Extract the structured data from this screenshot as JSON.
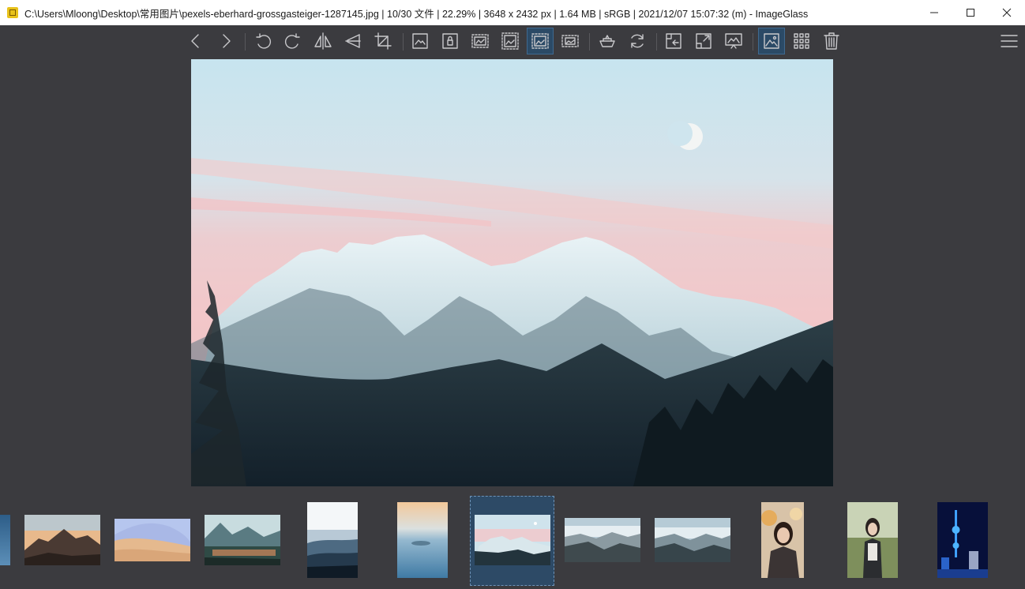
{
  "window": {
    "title": "C:\\Users\\Mloong\\Desktop\\常用图片\\pexels-eberhard-grossgasteiger-1287145.jpg  |  10/30 文件  |  22.29%  |  3648 x 2432 px  |  1.64 MB  |  sRGB  |  2021/12/07 15:07:32 (m)  - ImageGlass"
  },
  "toolbar": {
    "icons": [
      "prev-icon",
      "next-icon",
      "rotate-left-icon",
      "rotate-right-icon",
      "flip-horizontal-icon",
      "flip-vertical-icon",
      "crop-icon",
      "actual-size-icon",
      "lock-zoom-icon",
      "scale-to-width-icon",
      "scale-to-height-icon",
      "auto-zoom-icon",
      "scale-to-fill-icon",
      "checkerboard-icon",
      "refresh-icon",
      "open-location-icon",
      "fullscreen-icon",
      "slideshow-icon",
      "thumbnail-bar-icon",
      "gallery-icon",
      "delete-icon",
      "menu-icon"
    ],
    "active": [
      "auto-zoom-icon",
      "thumbnail-bar-icon"
    ]
  },
  "viewer": {
    "image": "snow-mountains-at-dusk"
  },
  "thumbnails": [
    {
      "name": "thumb-partial"
    },
    {
      "name": "thumb-mountain-sunset"
    },
    {
      "name": "thumb-desert"
    },
    {
      "name": "thumb-lake-forest"
    },
    {
      "name": "thumb-foggy-hills"
    },
    {
      "name": "thumb-sea-of-clouds"
    },
    {
      "name": "thumb-snow-mountains",
      "selected": true
    },
    {
      "name": "thumb-cloud-valley-1"
    },
    {
      "name": "thumb-cloud-valley-2"
    },
    {
      "name": "thumb-portrait-1"
    },
    {
      "name": "thumb-portrait-2"
    },
    {
      "name": "thumb-night-tower"
    }
  ]
}
